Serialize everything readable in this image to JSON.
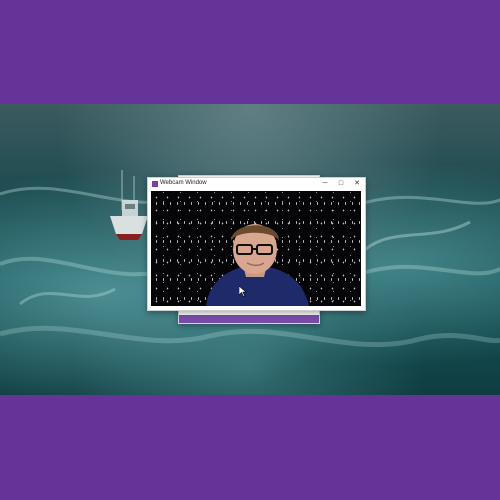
{
  "window": {
    "title": "Webcam Window",
    "minimize_glyph": "─",
    "maximize_glyph": "□",
    "close_glyph": "✕"
  },
  "icons": {
    "app": "app-icon",
    "cursor": "mouse-cursor-icon"
  },
  "colors": {
    "background_band": "#663399",
    "titlebar": "#ffffff",
    "accent": "#7a4aa8"
  }
}
